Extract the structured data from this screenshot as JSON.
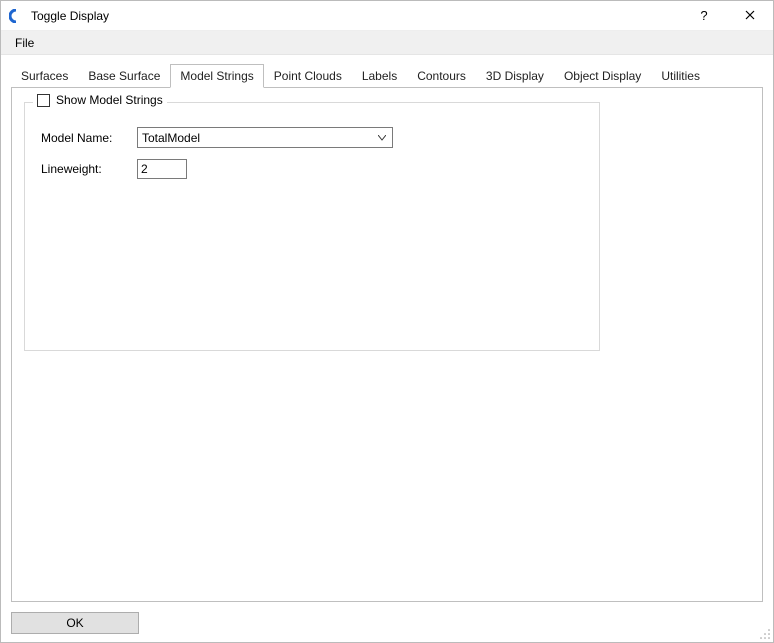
{
  "window": {
    "title": "Toggle Display"
  },
  "menu": {
    "file": "File"
  },
  "tabs": [
    {
      "label": "Surfaces"
    },
    {
      "label": "Base Surface"
    },
    {
      "label": "Model Strings"
    },
    {
      "label": "Point Clouds"
    },
    {
      "label": "Labels"
    },
    {
      "label": "Contours"
    },
    {
      "label": "3D Display"
    },
    {
      "label": "Object Display"
    },
    {
      "label": "Utilities"
    }
  ],
  "active_tab_index": 2,
  "panel": {
    "checkbox_label": "Show Model Strings",
    "checkbox_checked": false,
    "model_name_label": "Model Name:",
    "model_name_value": "TotalModel",
    "lineweight_label": "Lineweight:",
    "lineweight_value": "2"
  },
  "buttons": {
    "ok": "OK"
  }
}
